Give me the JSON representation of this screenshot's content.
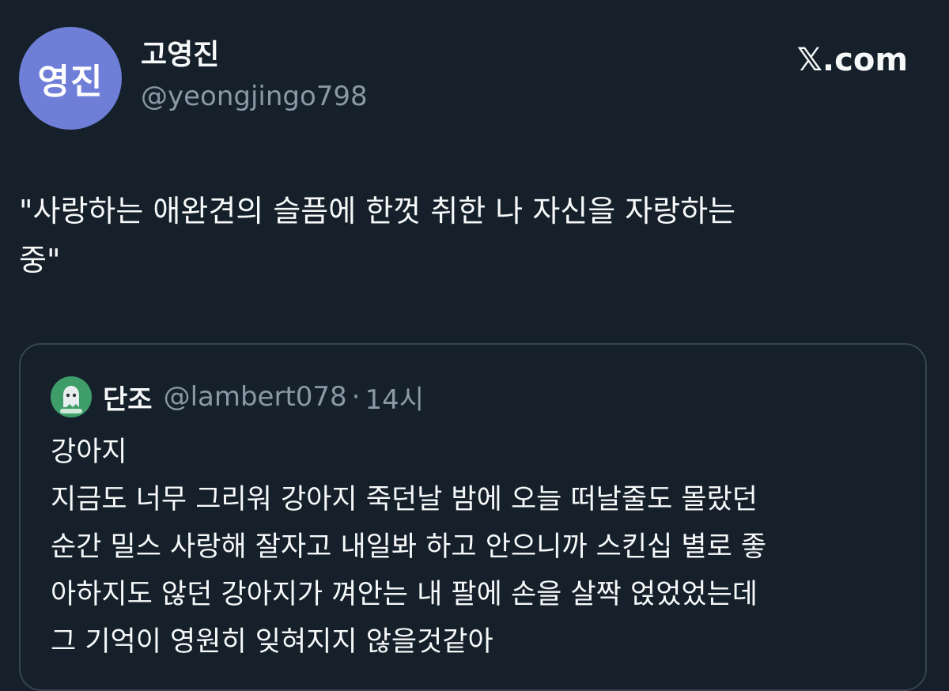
{
  "author": {
    "avatar_text": "영진",
    "display_name": "고영진",
    "handle": "@yeongjingo798",
    "avatar_color": "#6f7fd8"
  },
  "brand": {
    "label": "𝕏.com"
  },
  "tweet": {
    "lines": [
      "\"사랑하는 애완견의 슬픔에 한껏 취한 나 자신을 자랑하는",
      "중\""
    ]
  },
  "quoted_tweet": {
    "display_name": "단조",
    "handle": "@lambert078",
    "separator": "·",
    "time": "14시",
    "avatar_icon": "ghost-sticker-icon",
    "lines": [
      "강아지",
      "지금도 너무 그리워 강아지 죽던날 밤에 오늘 떠날줄도 몰랐던",
      "순간 밀스 사랑해 잘자고 내일봐 하고 안으니까 스킨십 별로 좋",
      "아하지도 않던 강아지가 껴안는 내 팔에 손을 살짝 얹었었는데",
      "그 기억이 영원히 잊혀지지 않을것같아"
    ]
  },
  "colors": {
    "background": "#15202b",
    "text_primary": "#f7f9f9",
    "text_secondary": "#8b98a5",
    "border": "#38444d"
  }
}
